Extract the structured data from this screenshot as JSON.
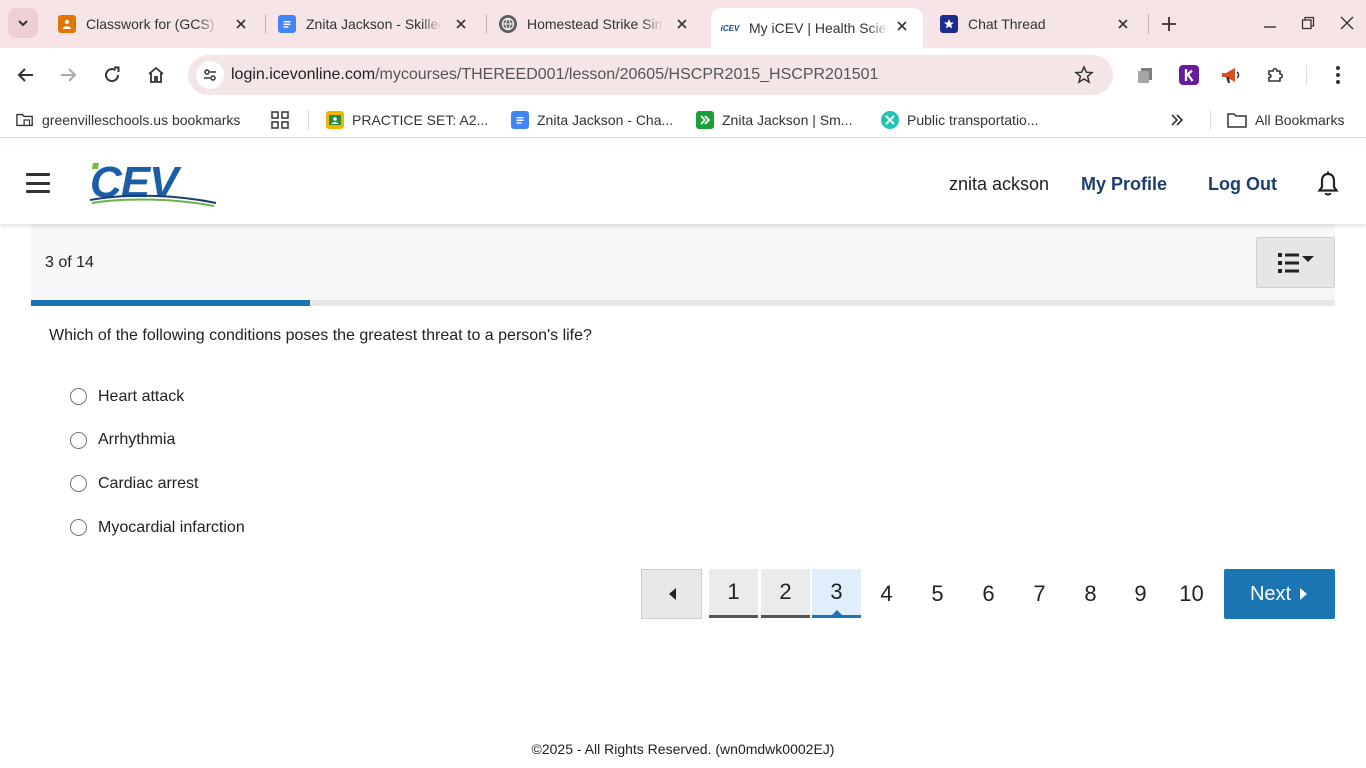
{
  "browser": {
    "tabs": [
      {
        "title": "Classwork for (GCS) ...",
        "icon": "classroom-icon",
        "active": false
      },
      {
        "title": "Znita Jackson - Skilled",
        "icon": "docs-icon",
        "active": false
      },
      {
        "title": "Homestead Strike Simulation",
        "icon": "globe-icon",
        "active": false
      },
      {
        "title": "My iCEV | Health Science",
        "icon": "icev-icon",
        "active": true
      },
      {
        "title": "Chat Thread",
        "icon": "star-badge-icon",
        "active": false
      }
    ],
    "url_domain": "login.icevonline.com",
    "url_path": "/mycourses/THEREED001/lesson/20605/HSCPR2015_HSCPR201501",
    "bookmarks": [
      {
        "label": "greenvilleschools.us bookmarks",
        "icon": "managed-folder-icon"
      },
      {
        "label": "PRACTICE SET: A2...",
        "icon": "classroom-icon"
      },
      {
        "label": "Znita Jackson - Cha...",
        "icon": "docs-icon"
      },
      {
        "label": "Znita Jackson | Sm...",
        "icon": "smartsheet-icon"
      },
      {
        "label": "Public transportatio...",
        "icon": "perplexity-icon"
      }
    ],
    "all_bookmarks_label": "All Bookmarks"
  },
  "header": {
    "user_name": "znita ackson",
    "profile_label": "My Profile",
    "logout_label": "Log Out",
    "logo_text": "iCEV"
  },
  "lesson": {
    "counter": "3 of 14",
    "progress": 0.2143,
    "question": "Which of the following conditions poses the greatest threat to a person's life?",
    "options": [
      "Heart attack",
      "Arrhythmia",
      "Cardiac arrest",
      "Myocardial infarction"
    ]
  },
  "pager": {
    "pages": [
      "1",
      "2",
      "3",
      "4",
      "5",
      "6",
      "7",
      "8",
      "9",
      "10"
    ],
    "current": 3,
    "visited": [
      1,
      2
    ],
    "next_label": "Next"
  },
  "footer": {
    "copyright": "©2025 - All Rights Reserved.",
    "code": "(wn0mdwk0002EJ)"
  },
  "colors": {
    "accent": "#1b75b3",
    "header_link": "#1c3e6e",
    "tabbar_bg": "#f7e4e7"
  }
}
